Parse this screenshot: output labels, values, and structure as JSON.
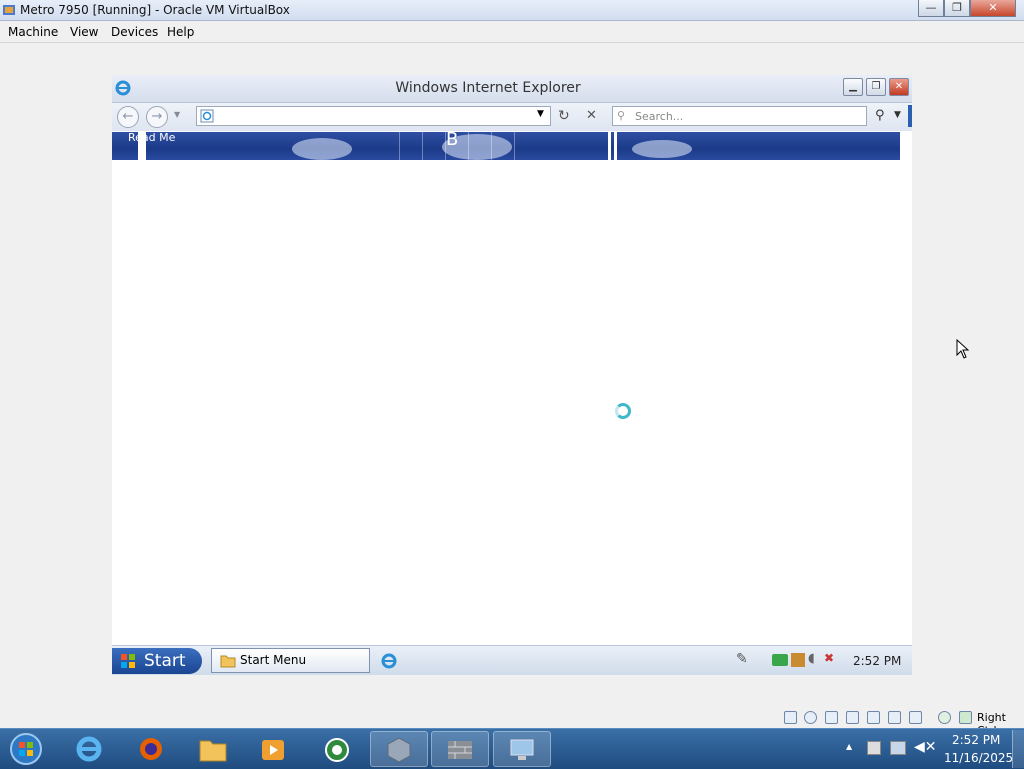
{
  "host": {
    "title": "Metro 7950 [Running] - Oracle VM VirtualBox",
    "menu": [
      "Machine",
      "View",
      "Devices",
      "Help"
    ],
    "window_controls": {
      "minimize": "—",
      "restore": "❐",
      "close": "✕"
    },
    "status_bar": {
      "host_key": "Right Ctrl"
    },
    "taskbar": {
      "apps": [
        "windows-orb",
        "internet-explorer",
        "firefox",
        "file-explorer",
        "media-player",
        "globe-app",
        "virtualbox",
        "firewall-app",
        "remote-desktop"
      ],
      "time": "2:52 PM",
      "date": "11/16/2025",
      "tray_chevron": "▲"
    }
  },
  "guest": {
    "ie_window": {
      "title": "Windows Internet Explorer",
      "search_placeholder": "Search...",
      "banner_texts": {
        "read_me": "Read Me",
        "letter": "B"
      }
    },
    "taskbar": {
      "start_label": "Start",
      "task_button": "Start Menu",
      "time": "2:52 PM"
    }
  },
  "colors": {
    "host_taskbar": "#2a5a8f",
    "ie_banner": "#1f3f8e",
    "spinner": "#3fb8c9",
    "close_red": "#c7462d"
  }
}
